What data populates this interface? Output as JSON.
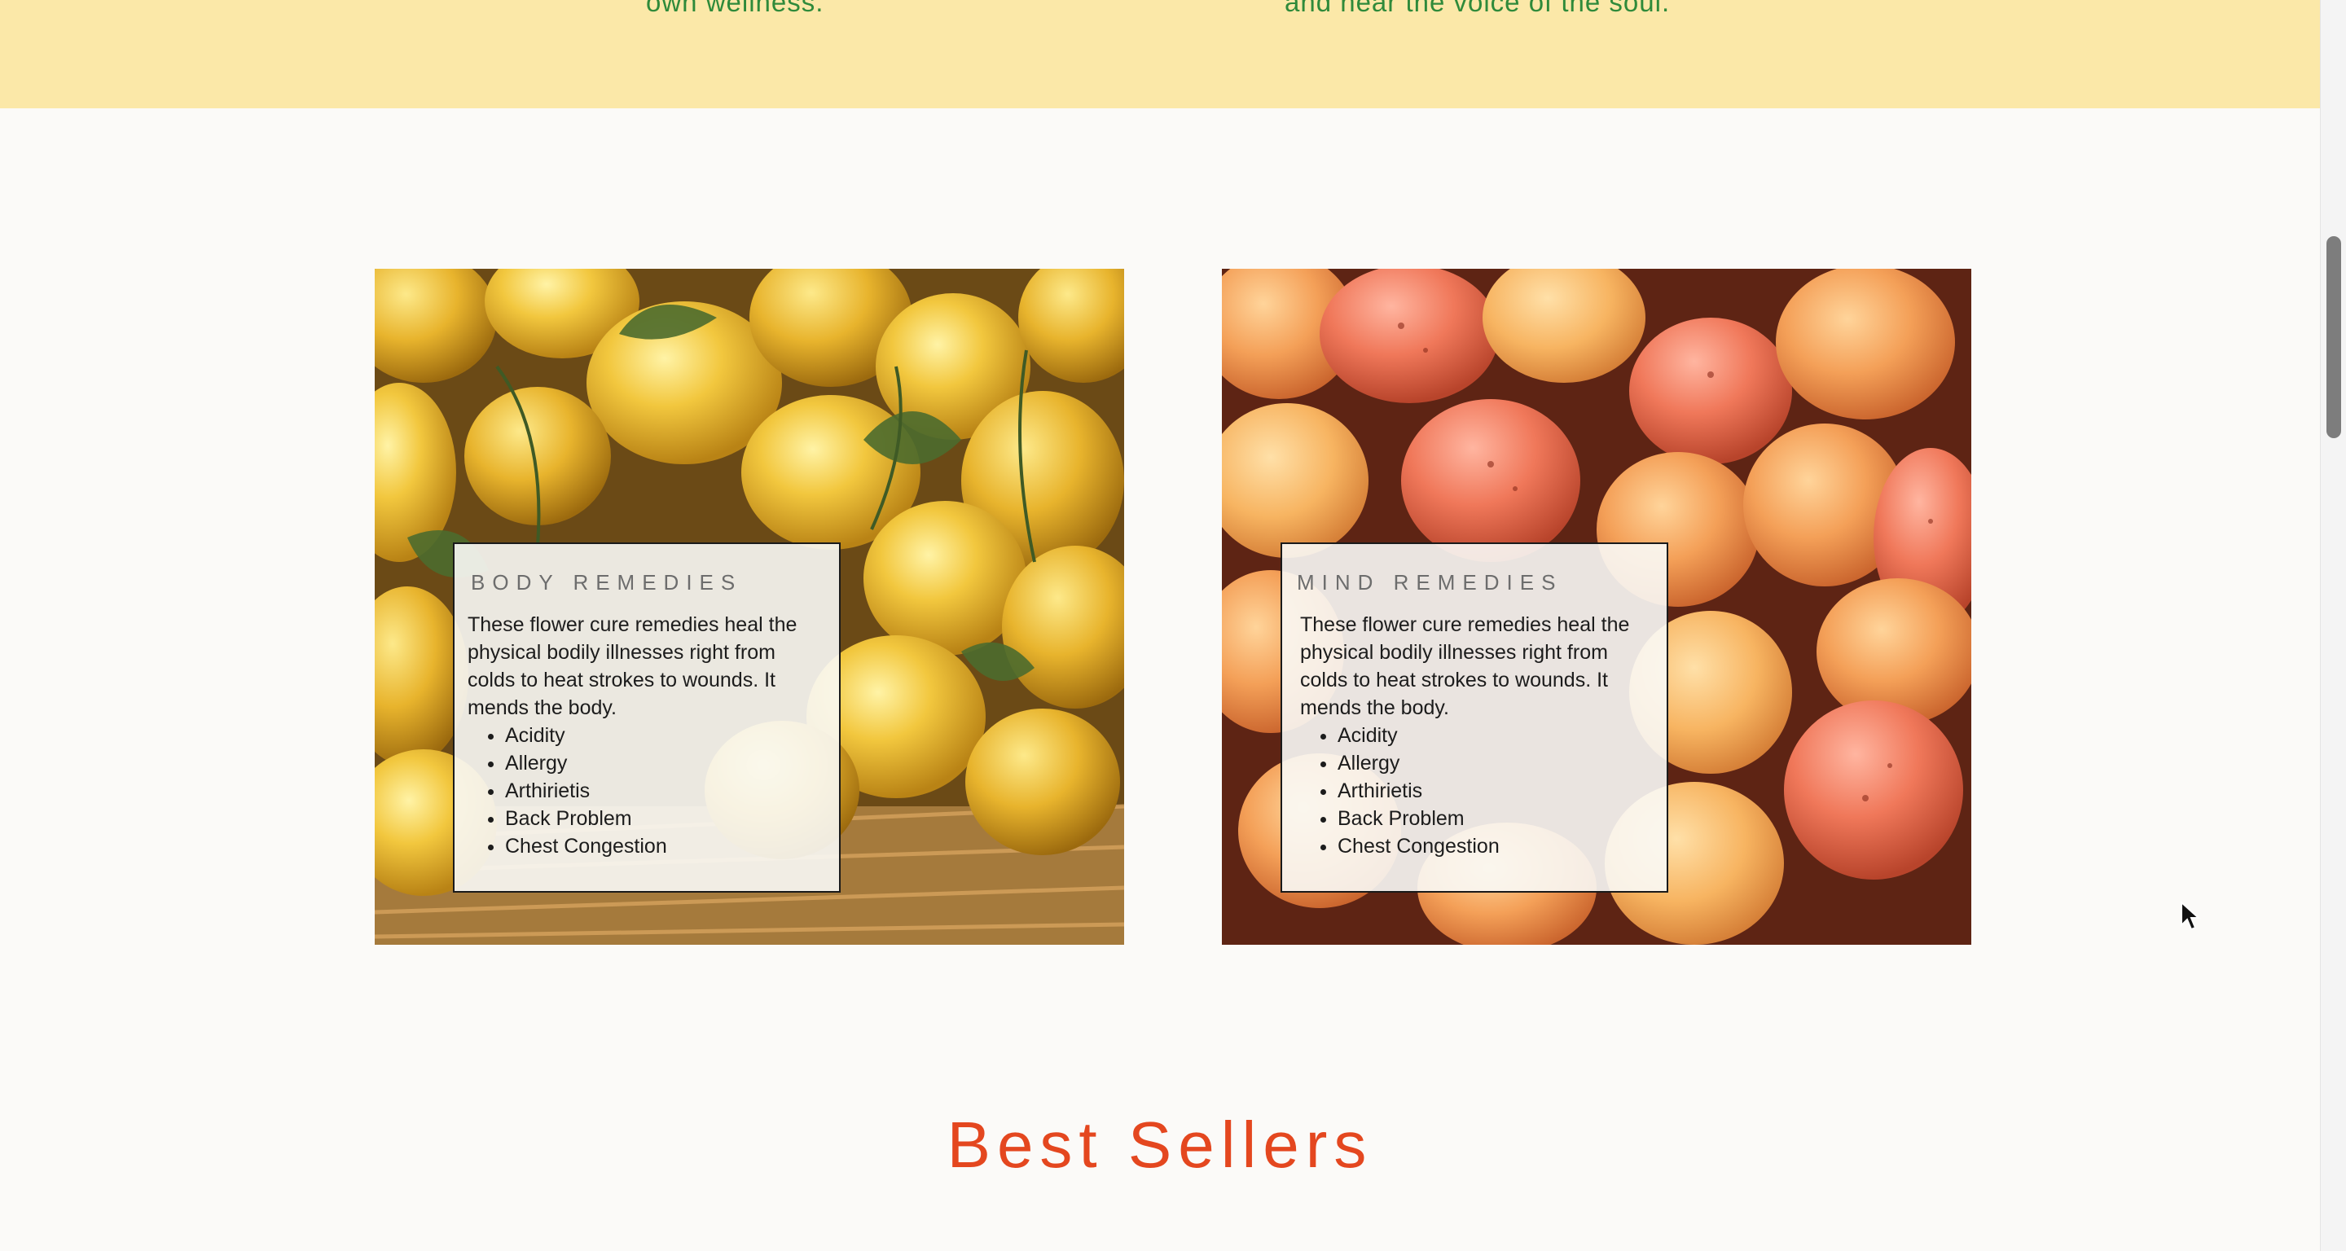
{
  "top_band": {
    "left_text": "own wellness.",
    "right_text": "and hear the voice of the soul."
  },
  "cards": [
    {
      "title": "BODY REMEDIES",
      "description": "These flower cure remedies heal the physical bodily illnesses right from colds to heat strokes to wounds. It mends the body.",
      "items": [
        "Acidity",
        "Allergy",
        "Arthirietis",
        "Back Problem",
        "Chest Congestion"
      ],
      "image": "lemons-in-basket"
    },
    {
      "title": "MIND REMEDIES",
      "description": "These flower cure remedies heal the physical bodily illnesses right from colds to heat strokes to wounds. It mends the body.",
      "items": [
        "Acidity",
        "Allergy",
        "Arthirietis",
        "Back Problem",
        "Chest Congestion"
      ],
      "image": "apricots-pile"
    }
  ],
  "section": {
    "heading": "Best Sellers"
  },
  "colors": {
    "band": "#fbe8a8",
    "band_text": "#2f8a3a",
    "heading": "#e4471f",
    "page": "#fbfaf8"
  },
  "icons": {
    "cursor": "arrow-cursor-icon"
  }
}
